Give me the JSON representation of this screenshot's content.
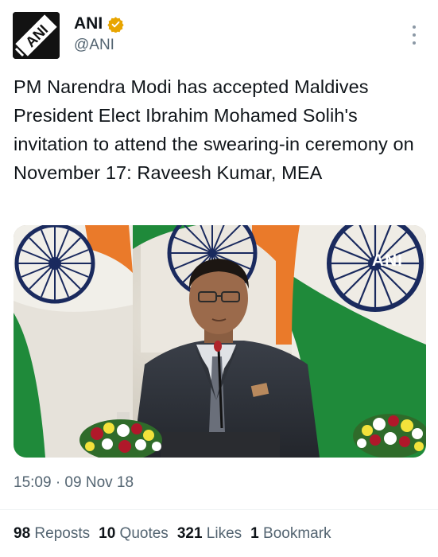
{
  "author": {
    "display_name": "ANI",
    "handle": "@ANI",
    "avatar_text": "ANI",
    "verified_color": "#e8a500"
  },
  "tweet": {
    "text": "PM Narendra Modi has accepted Maldives President Elect Ibrahim Mohamed Solih's invitation to attend the swearing-in ceremony on November 17: Raveesh Kumar, MEA",
    "media_watermark": "ANI"
  },
  "meta": {
    "timestamp": "15:09 · 09 Nov 18"
  },
  "stats": [
    {
      "count": "98",
      "label": "Reposts"
    },
    {
      "count": "10",
      "label": "Quotes"
    },
    {
      "count": "321",
      "label": "Likes"
    },
    {
      "count": "1",
      "label": "Bookmark"
    }
  ],
  "colors": {
    "text_primary": "#0f1419",
    "text_secondary": "#536471",
    "flag_saffron": "#ea7a2a",
    "flag_green": "#1f8a3a",
    "chakra_navy": "#1a2a5e"
  },
  "icons": {
    "more": "more-vertical-icon",
    "verified": "verified-badge-icon"
  }
}
